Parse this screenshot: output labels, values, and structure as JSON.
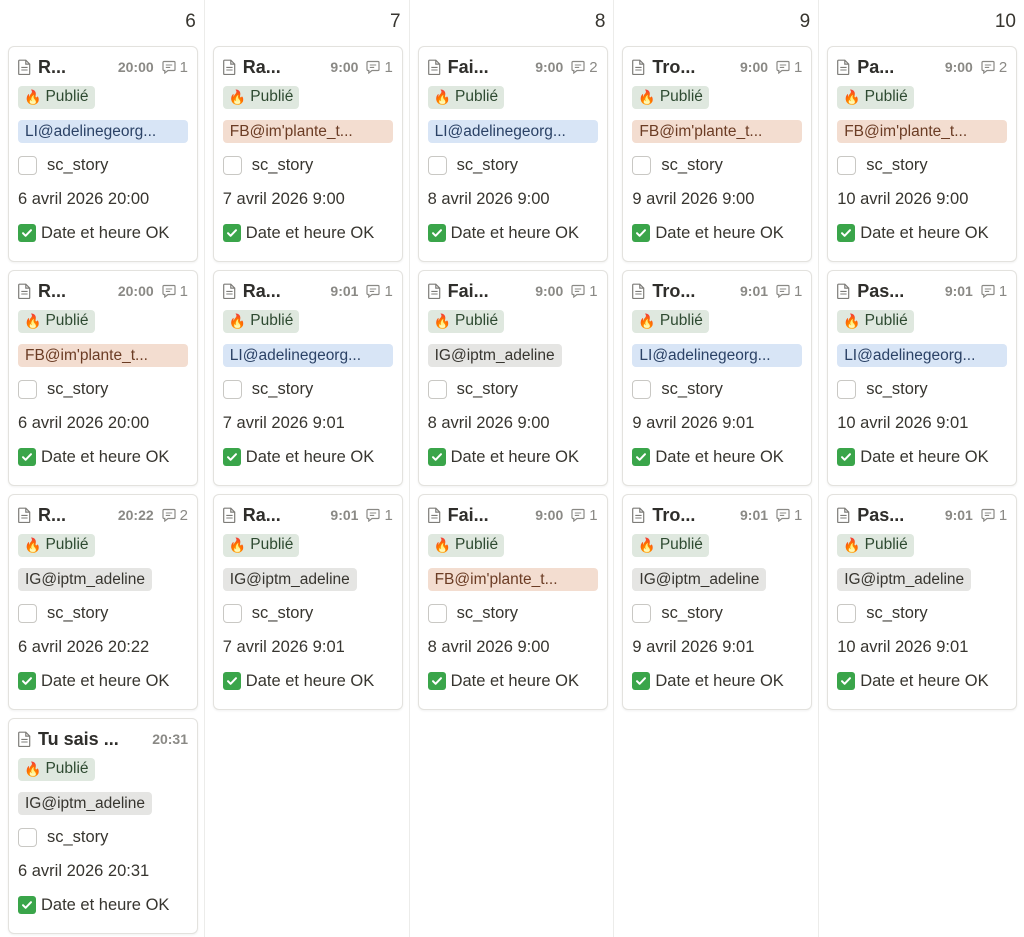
{
  "board": {
    "columns": [
      {
        "day": "6",
        "cards": [
          {
            "title": "R...",
            "time": "20:00",
            "comments": "1",
            "status": "Publié",
            "account": "LI@adelinegeorg...",
            "account_type": "li",
            "checkbox_label": "sc_story",
            "date": "6 avril 2026 20:00",
            "ok_label": "Date et heure OK"
          },
          {
            "title": "R...",
            "time": "20:00",
            "comments": "1",
            "status": "Publié",
            "account": "FB@im'plante_t...",
            "account_type": "fb",
            "checkbox_label": "sc_story",
            "date": "6 avril 2026 20:00",
            "ok_label": "Date et heure OK"
          },
          {
            "title": "R...",
            "time": "20:22",
            "comments": "2",
            "status": "Publié",
            "account": "IG@iptm_adeline",
            "account_type": "ig",
            "checkbox_label": "sc_story",
            "date": "6 avril 2026 20:22",
            "ok_label": "Date et heure OK"
          },
          {
            "title": "Tu sais ...",
            "time": "20:31",
            "comments": "",
            "status": "Publié",
            "account": "IG@iptm_adeline",
            "account_type": "ig",
            "checkbox_label": "sc_story",
            "date": "6 avril 2026 20:31",
            "ok_label": "Date et heure OK"
          }
        ]
      },
      {
        "day": "7",
        "cards": [
          {
            "title": "Ra...",
            "time": "9:00",
            "comments": "1",
            "status": "Publié",
            "account": "FB@im'plante_t...",
            "account_type": "fb",
            "checkbox_label": "sc_story",
            "date": "7 avril 2026 9:00",
            "ok_label": "Date et heure OK"
          },
          {
            "title": "Ra...",
            "time": "9:01",
            "comments": "1",
            "status": "Publié",
            "account": "LI@adelinegeorg...",
            "account_type": "li",
            "checkbox_label": "sc_story",
            "date": "7 avril 2026 9:01",
            "ok_label": "Date et heure OK"
          },
          {
            "title": "Ra...",
            "time": "9:01",
            "comments": "1",
            "status": "Publié",
            "account": "IG@iptm_adeline",
            "account_type": "ig",
            "checkbox_label": "sc_story",
            "date": "7 avril 2026 9:01",
            "ok_label": "Date et heure OK"
          }
        ]
      },
      {
        "day": "8",
        "cards": [
          {
            "title": "Fai...",
            "time": "9:00",
            "comments": "2",
            "status": "Publié",
            "account": "LI@adelinegeorg...",
            "account_type": "li",
            "checkbox_label": "sc_story",
            "date": "8 avril 2026 9:00",
            "ok_label": "Date et heure OK"
          },
          {
            "title": "Fai...",
            "time": "9:00",
            "comments": "1",
            "status": "Publié",
            "account": "IG@iptm_adeline",
            "account_type": "ig",
            "checkbox_label": "sc_story",
            "date": "8 avril 2026 9:00",
            "ok_label": "Date et heure OK"
          },
          {
            "title": "Fai...",
            "time": "9:00",
            "comments": "1",
            "status": "Publié",
            "account": "FB@im'plante_t...",
            "account_type": "fb",
            "checkbox_label": "sc_story",
            "date": "8 avril 2026 9:00",
            "ok_label": "Date et heure OK"
          }
        ]
      },
      {
        "day": "9",
        "cards": [
          {
            "title": "Tro...",
            "time": "9:00",
            "comments": "1",
            "status": "Publié",
            "account": "FB@im'plante_t...",
            "account_type": "fb",
            "checkbox_label": "sc_story",
            "date": "9 avril 2026 9:00",
            "ok_label": "Date et heure OK"
          },
          {
            "title": "Tro...",
            "time": "9:01",
            "comments": "1",
            "status": "Publié",
            "account": "LI@adelinegeorg...",
            "account_type": "li",
            "checkbox_label": "sc_story",
            "date": "9 avril 2026 9:01",
            "ok_label": "Date et heure OK"
          },
          {
            "title": "Tro...",
            "time": "9:01",
            "comments": "1",
            "status": "Publié",
            "account": "IG@iptm_adeline",
            "account_type": "ig",
            "checkbox_label": "sc_story",
            "date": "9 avril 2026 9:01",
            "ok_label": "Date et heure OK"
          }
        ]
      },
      {
        "day": "10",
        "cards": [
          {
            "title": "Pa...",
            "time": "9:00",
            "comments": "2",
            "status": "Publié",
            "account": "FB@im'plante_t...",
            "account_type": "fb",
            "checkbox_label": "sc_story",
            "date": "10 avril 2026 9:00",
            "ok_label": "Date et heure OK"
          },
          {
            "title": "Pas...",
            "time": "9:01",
            "comments": "1",
            "status": "Publié",
            "account": "LI@adelinegeorg...",
            "account_type": "li",
            "checkbox_label": "sc_story",
            "date": "10 avril 2026 9:01",
            "ok_label": "Date et heure OK"
          },
          {
            "title": "Pas...",
            "time": "9:01",
            "comments": "1",
            "status": "Publié",
            "account": "IG@iptm_adeline",
            "account_type": "ig",
            "checkbox_label": "sc_story",
            "date": "10 avril 2026 9:01",
            "ok_label": "Date et heure OK"
          }
        ]
      }
    ]
  },
  "icons": {
    "page": "document-icon",
    "comment": "comment-icon",
    "status": "fire-icon",
    "ok": "check-box-icon"
  },
  "colors": {
    "status_bg": "#dfe8df",
    "li_tag": "#d8e5f6",
    "fb_tag": "#f3ddd0",
    "ig_tag": "#e5e5e3",
    "ok_green": "#3aa54a"
  }
}
